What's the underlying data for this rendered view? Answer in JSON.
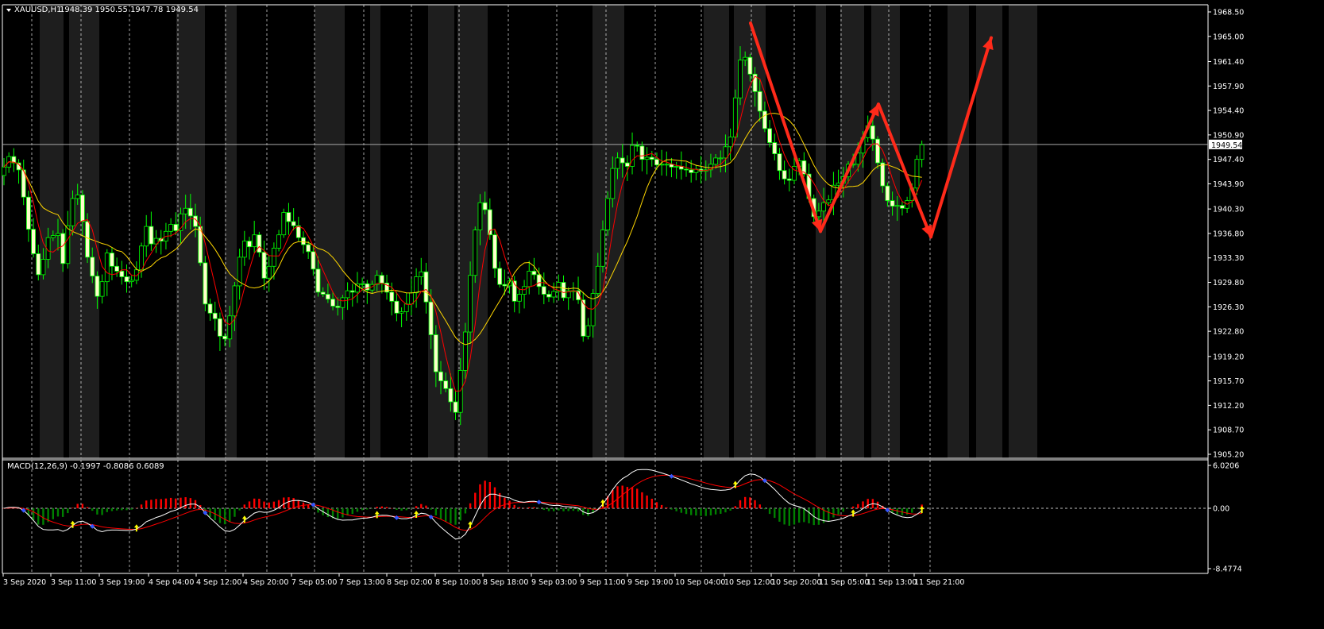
{
  "header": {
    "symbol": "XAUUSD,H1",
    "ohlc": "1948.39 1950.55 1947.78 1949.54",
    "collapse_icon": "triangle-down-icon"
  },
  "macd_header": {
    "label": "MACD(12,26,9) -0.1997 -0.8086 0.6089"
  },
  "current_price_label": "1949.54",
  "colors": {
    "background": "#000000",
    "shade": "#1e1e1e",
    "candle_outline": "#00ff00",
    "candle_bull_fill": "#000000",
    "candle_bear_fill": "#ffffcc",
    "ma_fast": "#ff0000",
    "ma_slow": "#ffd700",
    "macd_line": "#ffffff",
    "signal_line": "#ff0000",
    "hist_positive": "#ff0000",
    "hist_negative": "#008000",
    "grid": "#ffffff",
    "arrows": "#ff2a1a"
  },
  "chart_data": [
    {
      "type": "candlestick",
      "title": "XAUUSD,H1",
      "price_axis_ticks": [
        "1968.50",
        "1965.00",
        "1961.40",
        "1957.90",
        "1954.40",
        "1950.90",
        "1947.40",
        "1943.90",
        "1940.30",
        "1936.80",
        "1933.30",
        "1929.80",
        "1926.30",
        "1922.80",
        "1919.20",
        "1915.70",
        "1912.20",
        "1908.70",
        "1905.20"
      ],
      "ylim": [
        1905.2,
        1968.5
      ],
      "time_axis_labels": [
        "3 Sep 2020",
        "3 Sep 11:00",
        "3 Sep 19:00",
        "4 Sep 04:00",
        "4 Sep 12:00",
        "4 Sep 20:00",
        "7 Sep 05:00",
        "7 Sep 13:00",
        "8 Sep 02:00",
        "8 Sep 10:00",
        "8 Sep 18:00",
        "9 Sep 03:00",
        "9 Sep 11:00",
        "9 Sep 19:00",
        "10 Sep 04:00",
        "10 Sep 12:00",
        "10 Sep 20:00",
        "11 Sep 05:00",
        "11 Sep 13:00",
        "11 Sep 21:00"
      ],
      "last_price": 1949.54,
      "close": [
        1946.3,
        1947.8,
        1946.9,
        1945.9,
        1942.0,
        1937.4,
        1933.9,
        1930.9,
        1933.1,
        1936.2,
        1936.5,
        1936.8,
        1932.5,
        1937.9,
        1941.8,
        1942.3,
        1938.5,
        1933.4,
        1930.7,
        1927.8,
        1929.9,
        1934.0,
        1932.1,
        1931.4,
        1930.6,
        1929.9,
        1930.1,
        1931.6,
        1935.0,
        1937.8,
        1935.3,
        1936.1,
        1935.7,
        1937.1,
        1938.1,
        1937.2,
        1939.6,
        1940.4,
        1939.3,
        1937.8,
        1932.6,
        1926.7,
        1925.4,
        1924.6,
        1922.1,
        1921.7,
        1925.0,
        1929.3,
        1933.4,
        1935.7,
        1934.9,
        1936.6,
        1934.1,
        1930.4,
        1932.1,
        1934.7,
        1936.6,
        1939.8,
        1938.5,
        1937.9,
        1936.2,
        1935.2,
        1934.2,
        1931.7,
        1928.4,
        1928.1,
        1927.4,
        1926.4,
        1926.2,
        1927.6,
        1928.6,
        1928.4,
        1929.6,
        1929.6,
        1928.7,
        1929.5,
        1930.8,
        1929.7,
        1928.4,
        1927.1,
        1925.4,
        1925.6,
        1926.7,
        1928.3,
        1930.6,
        1931.3,
        1927.0,
        1922.3,
        1917.0,
        1915.7,
        1914.6,
        1912.7,
        1911.2,
        1917.2,
        1922.7,
        1930.8,
        1937.3,
        1941.2,
        1940.2,
        1936.6,
        1931.8,
        1929.5,
        1929.3,
        1930.0,
        1927.1,
        1928.1,
        1929.2,
        1931.4,
        1930.9,
        1929.2,
        1928.1,
        1927.7,
        1928.5,
        1929.8,
        1927.6,
        1928.6,
        1928.6,
        1927.3,
        1922.1,
        1923.6,
        1928.2,
        1932.1,
        1937.3,
        1941.8,
        1946.1,
        1947.6,
        1946.9,
        1946.4,
        1949.4,
        1949.3,
        1947.4,
        1947.7,
        1947.4,
        1946.6,
        1946.7,
        1946.7,
        1946.3,
        1946.4,
        1946.0,
        1945.9,
        1945.5,
        1946.0,
        1945.7,
        1945.9,
        1946.7,
        1947.6,
        1947.6,
        1949.2,
        1950.6,
        1956.2,
        1961.6,
        1962.0,
        1959.6,
        1957.1,
        1954.3,
        1951.8,
        1949.8,
        1948.2,
        1945.8,
        1944.6,
        1944.4,
        1946.4,
        1947.2,
        1945.3,
        1941.8,
        1939.2,
        1940.0,
        1941.2,
        1941.6,
        1943.7,
        1944.0,
        1944.9,
        1946.7,
        1946.7,
        1948.3,
        1950.5,
        1952.2,
        1950.3,
        1946.9,
        1943.6,
        1941.5,
        1940.7,
        1940.8,
        1940.4,
        1941.5,
        1943.3,
        1947.4,
        1949.5
      ],
      "ma_fast_description": "red moving average",
      "ma_slow_description": "gold moving average",
      "annotations": "red zigzag arrows drawn over price"
    },
    {
      "type": "macd",
      "title": "MACD(12,26,9) -0.1997 -0.8086 0.6089",
      "axis_ticks": [
        "6.0206",
        "0.00",
        "-8.4774"
      ],
      "ylim": [
        -8.4774,
        6.0206
      ],
      "macd_value": -0.1997,
      "signal_value": -0.8086,
      "histogram_value": 0.6089
    }
  ]
}
